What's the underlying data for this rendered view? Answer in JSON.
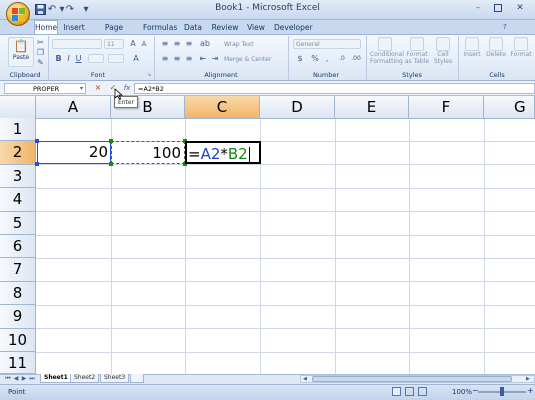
{
  "window": {
    "title": "Book1 - Microsoft Excel"
  },
  "qat": {
    "save_icon": "save-icon",
    "undo_icon": "undo-icon",
    "redo_icon": "redo-icon",
    "customize_icon": "chevron-down-icon"
  },
  "ribbon": {
    "tabs": [
      "Home",
      "Insert",
      "Page Layout",
      "Formulas",
      "Data",
      "Review",
      "View",
      "Developer"
    ],
    "active_tab": "Home",
    "clipboard": {
      "paste_label": "Paste",
      "group_label": "Clipboard"
    },
    "font": {
      "font_size": "11",
      "group_label": "Font"
    },
    "alignment": {
      "wrap_text": "Wrap Text",
      "merge_center": "Merge & Center",
      "group_label": "Alignment"
    },
    "number": {
      "format": "General",
      "group_label": "Number"
    },
    "styles": {
      "conditional_formatting": "Conditional Formatting",
      "format_as_table": "Format as Table",
      "cell_styles": "Cell Styles",
      "group_label": "Styles"
    },
    "cells": {
      "insert": "Insert",
      "delete": "Delete",
      "format": "Format",
      "group_label": "Cells"
    }
  },
  "formula_bar": {
    "name_box": "PROPER",
    "cancel_icon": "×",
    "enter_icon": "✓",
    "fx_label": "fx",
    "formula": "=A2*B2",
    "tooltip": "Enter"
  },
  "grid": {
    "columns": [
      "A",
      "B",
      "C",
      "D",
      "E",
      "F",
      "G"
    ],
    "selected_column": "C",
    "rows": [
      "1",
      "2",
      "3",
      "4",
      "5",
      "6",
      "7",
      "8",
      "9",
      "10",
      "11"
    ],
    "selected_row": "2",
    "cells": {
      "A2": "20",
      "B2": "100",
      "C2": {
        "eq": "=",
        "ref1": "A2",
        "op": "*",
        "ref2": "B2"
      }
    },
    "ref_colors": {
      "A2": "#1c3fd6",
      "B2": "#138a13"
    }
  },
  "sheets": {
    "tabs": [
      "Sheet1",
      "Sheet2",
      "Sheet3"
    ],
    "active": "Sheet1"
  },
  "status": {
    "mode": "Point",
    "zoom": "100%"
  }
}
